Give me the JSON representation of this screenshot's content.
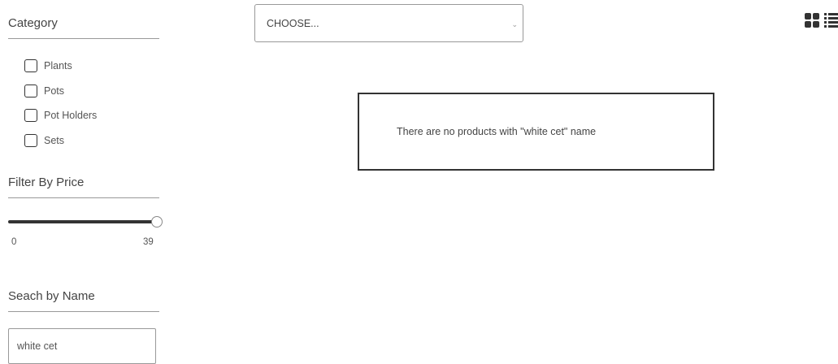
{
  "sidebar": {
    "category_title": "Category",
    "categories": [
      {
        "label": "Plants"
      },
      {
        "label": "Pots"
      },
      {
        "label": "Pot Holders"
      },
      {
        "label": "Sets"
      }
    ],
    "price_title": "Filter By Price",
    "price": {
      "min": "0",
      "max": "39",
      "current": 39
    },
    "name_title": "Seach by Name",
    "name_value": "white cet"
  },
  "toolbar": {
    "sort_select_value": "CHOOSE...",
    "icons": [
      "grid-view-icon",
      "list-view-icon"
    ]
  },
  "results": {
    "empty_message": "There are no products with \"white cet\" name"
  }
}
